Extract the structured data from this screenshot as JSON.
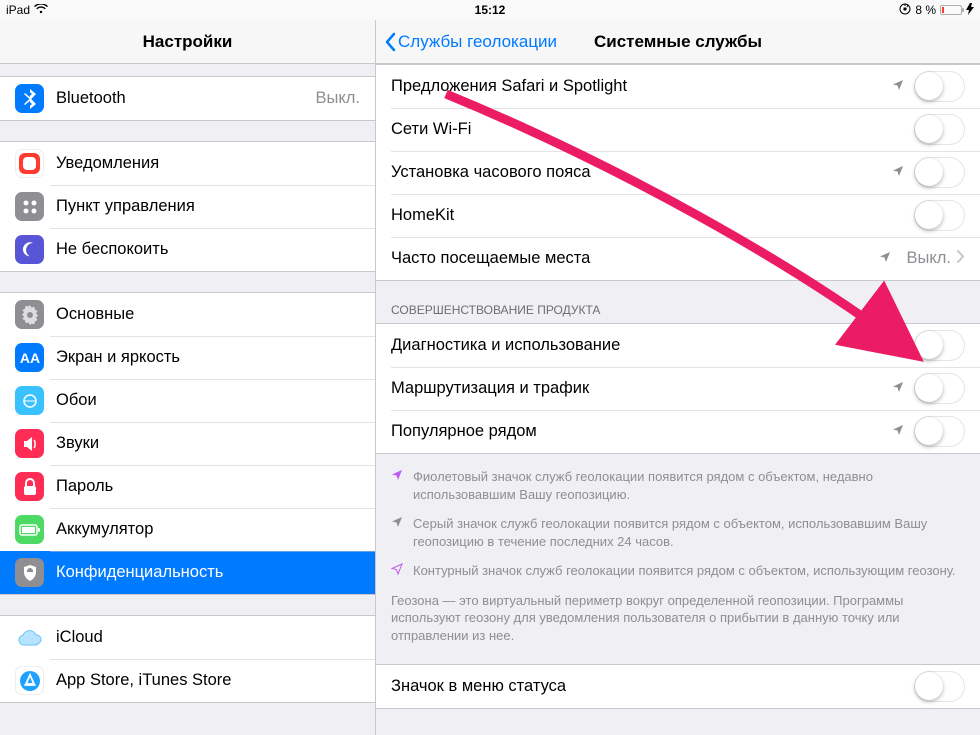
{
  "status": {
    "carrier": "iPad",
    "time": "15:12",
    "battery_pct": "8 %"
  },
  "sidebar": {
    "title": "Настройки",
    "groups": [
      {
        "rows": [
          {
            "id": "bluetooth",
            "label": "Bluetooth",
            "value": "Выкл."
          }
        ]
      },
      {
        "rows": [
          {
            "id": "notifications",
            "label": "Уведомления"
          },
          {
            "id": "control-center",
            "label": "Пункт управления"
          },
          {
            "id": "dnd",
            "label": "Не беспокоить"
          }
        ]
      },
      {
        "rows": [
          {
            "id": "general",
            "label": "Основные"
          },
          {
            "id": "display",
            "label": "Экран и яркость"
          },
          {
            "id": "wallpaper",
            "label": "Обои"
          },
          {
            "id": "sounds",
            "label": "Звуки"
          },
          {
            "id": "passcode",
            "label": "Пароль"
          },
          {
            "id": "battery",
            "label": "Аккумулятор"
          },
          {
            "id": "privacy",
            "label": "Конфиденциальность"
          }
        ]
      },
      {
        "rows": [
          {
            "id": "icloud",
            "label": "iCloud",
            "value": ""
          },
          {
            "id": "app-store",
            "label": "App Store, iTunes Store"
          }
        ]
      }
    ]
  },
  "detail": {
    "back_label": "Службы геолокации",
    "title": "Системные службы",
    "groups": [
      {
        "header": "",
        "rows": [
          {
            "label": "Предложения Safari и Spotlight",
            "type": "toggle",
            "on": false,
            "loc_icon": "gray"
          },
          {
            "label": "Сети Wi-Fi",
            "type": "toggle",
            "on": false
          },
          {
            "label": "Установка часового пояса",
            "type": "toggle",
            "on": false,
            "loc_icon": "gray"
          },
          {
            "label": "HomeKit",
            "type": "toggle",
            "on": false
          },
          {
            "label": "Часто посещаемые места",
            "type": "link",
            "value": "Выкл.",
            "loc_icon": "gray"
          }
        ]
      },
      {
        "header": "СОВЕРШЕНСТВОВАНИЕ ПРОДУКТА",
        "rows": [
          {
            "label": "Диагностика и использование",
            "type": "toggle",
            "on": false
          },
          {
            "label": "Маршрутизация и трафик",
            "type": "toggle",
            "on": false,
            "loc_icon": "gray"
          },
          {
            "label": "Популярное рядом",
            "type": "toggle",
            "on": false,
            "loc_icon": "gray"
          }
        ]
      }
    ],
    "legend": {
      "items": [
        {
          "icon": "purple",
          "text": "Фиолетовый значок служб геолокации появится рядом с объектом, недавно использовавшим Вашу геопозицию."
        },
        {
          "icon": "gray",
          "text": "Серый значок служб геолокации появится рядом с объектом, использовавшим Вашу геопозицию в течение последних 24 часов."
        },
        {
          "icon": "outline",
          "text": "Контурный значок служб геолокации появится рядом с объектом, использующим геозону."
        }
      ],
      "paragraph": "Геозона — это виртуальный периметр вокруг определенной геопозиции. Программы используют геозону для уведомления пользователя о прибытии в данную точку или отправлении из нее."
    },
    "bottom_group": {
      "rows": [
        {
          "label": "Значок в меню статуса",
          "type": "toggle",
          "on": false
        }
      ]
    }
  }
}
